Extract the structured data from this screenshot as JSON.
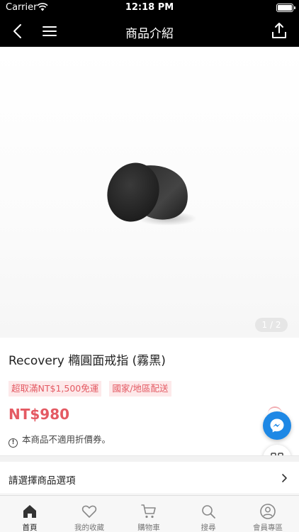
{
  "status_bar": {
    "carrier": "Carrier",
    "time": "12:18 PM"
  },
  "nav": {
    "title": "商品介紹"
  },
  "gallery": {
    "pager": "1 / 2"
  },
  "product": {
    "name": "Recovery 橢圓面戒指 (霧黑)",
    "tags": [
      "超取滿NT$1,500免運",
      "國家/地區配送"
    ],
    "price": "NT$980",
    "notice": "本商品不適用折價券。"
  },
  "options": {
    "label": "請選擇商品選項"
  },
  "tab_bar": {
    "items": [
      {
        "label": "首頁",
        "icon": "home-icon",
        "active": true
      },
      {
        "label": "我的收藏",
        "icon": "heart-icon",
        "active": false
      },
      {
        "label": "購物車",
        "icon": "cart-icon",
        "active": false
      },
      {
        "label": "搜尋",
        "icon": "search-icon",
        "active": false
      },
      {
        "label": "會員專區",
        "icon": "user-icon",
        "active": false
      }
    ]
  },
  "colors": {
    "accent": "#e45a63",
    "header": "#000000",
    "messenger": "#1e88e5"
  }
}
